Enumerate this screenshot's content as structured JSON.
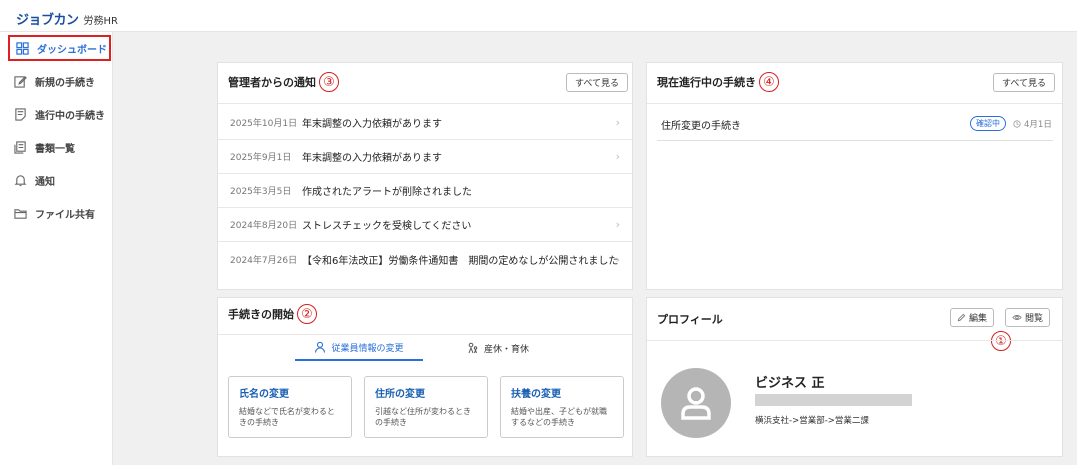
{
  "header": {
    "logo_main": "ジョブカン",
    "logo_sub": "労務HR"
  },
  "sidebar": {
    "items": [
      {
        "label": "ダッシュボード",
        "icon": "dashboard-grid-icon",
        "active": true
      },
      {
        "label": "新規の手続き",
        "icon": "edit-icon"
      },
      {
        "label": "進行中の手続き",
        "icon": "document-list-icon"
      },
      {
        "label": "書類一覧",
        "icon": "documents-icon"
      },
      {
        "label": "通知",
        "icon": "bell-icon"
      },
      {
        "label": "ファイル共有",
        "icon": "folder-icon"
      }
    ]
  },
  "notices": {
    "title": "管理者からの通知",
    "annotation": "③",
    "see_all": "すべて見る",
    "items": [
      {
        "date": "2025年10月1日",
        "text": "年末調整の入力依頼があります",
        "chevron": true
      },
      {
        "date": "2025年9月1日",
        "text": "年末調整の入力依頼があります",
        "chevron": true
      },
      {
        "date": "2025年3月5日",
        "text": "作成されたアラートが削除されました",
        "chevron": false
      },
      {
        "date": "2024年8月20日",
        "text": "ストレスチェックを受検してください",
        "chevron": true
      },
      {
        "date": "2024年7月26日",
        "text": "【令和6年法改正】労働条件通知書　期間の定めなしが公開されました",
        "chevron": true
      }
    ]
  },
  "in_progress": {
    "title": "現在進行中の手続き",
    "annotation": "④",
    "see_all": "すべて見る",
    "items": [
      {
        "name": "住所変更の手続き",
        "status": "確認中",
        "date": "4月1日"
      }
    ]
  },
  "start": {
    "title": "手続きの開始",
    "annotation": "②",
    "tabs": [
      {
        "label": "従業員情報の変更",
        "icon": "person-icon",
        "active": true
      },
      {
        "label": "産休・育休",
        "icon": "family-icon"
      }
    ],
    "cards": [
      {
        "title": "氏名の変更",
        "desc": "結婚などで氏名が変わるときの手続き"
      },
      {
        "title": "住所の変更",
        "desc": "引越など住所が変わるときの手続き"
      },
      {
        "title": "扶養の変更",
        "desc": "結婚や出産、子どもが就職するなどの手続き"
      }
    ]
  },
  "profile": {
    "title": "プロフィール",
    "edit": "編集",
    "view": "閲覧",
    "annotation": "①",
    "name": "ビジネス 正",
    "dept": "横浜支社->営業部->営業二課"
  },
  "colors": {
    "accent": "#2a6fdb",
    "annotation_red": "#d42020",
    "logo_blue": "#1a4f9c"
  }
}
